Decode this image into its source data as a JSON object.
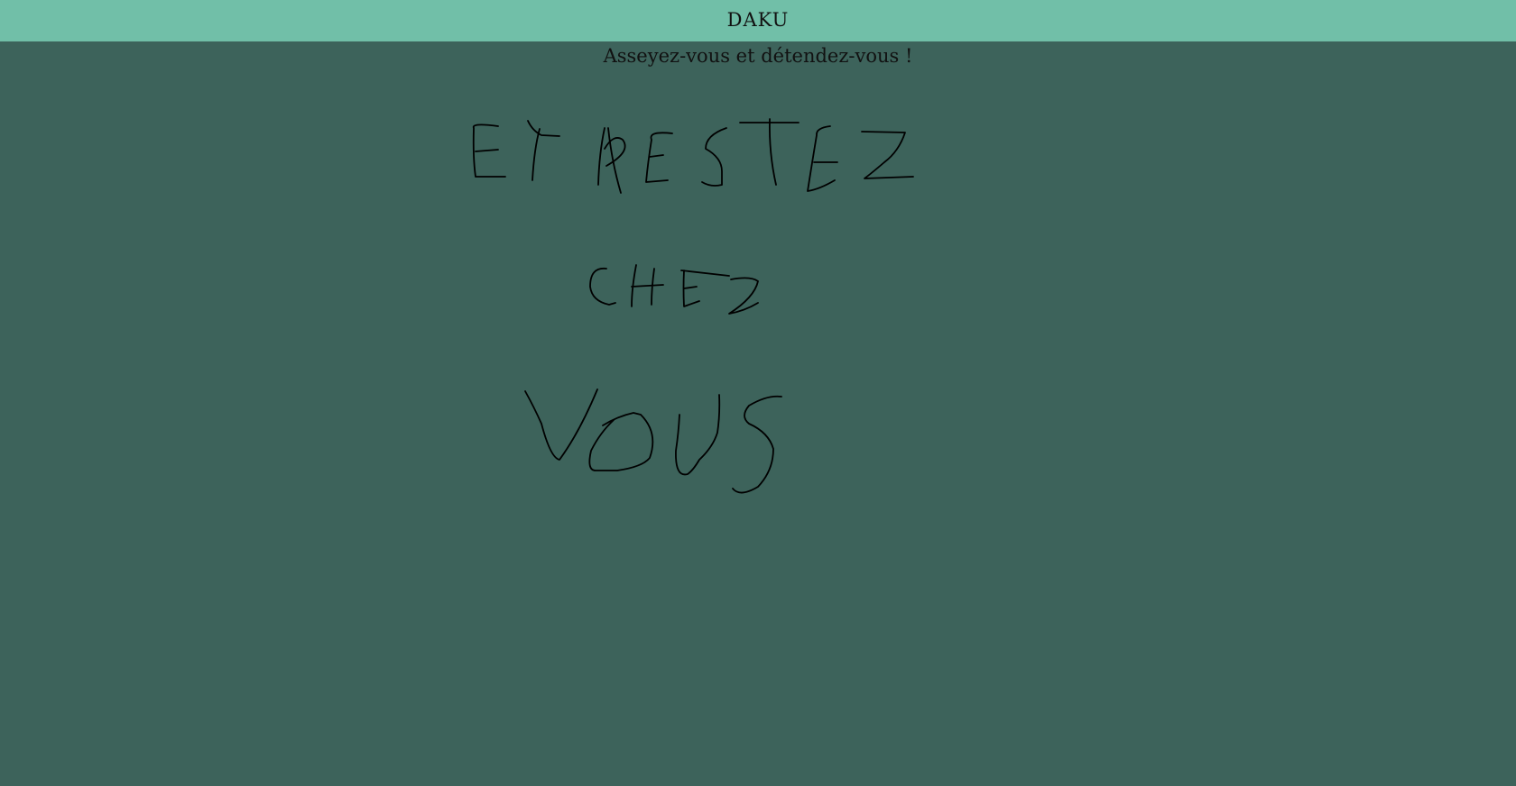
{
  "header": {
    "title": "DAKU"
  },
  "main": {
    "subtitle": "Asseyez-vous et détendez-vous !",
    "colors": {
      "header_background": "#71bfa8",
      "page_background": "#3d635b",
      "ink": "#000000"
    }
  }
}
